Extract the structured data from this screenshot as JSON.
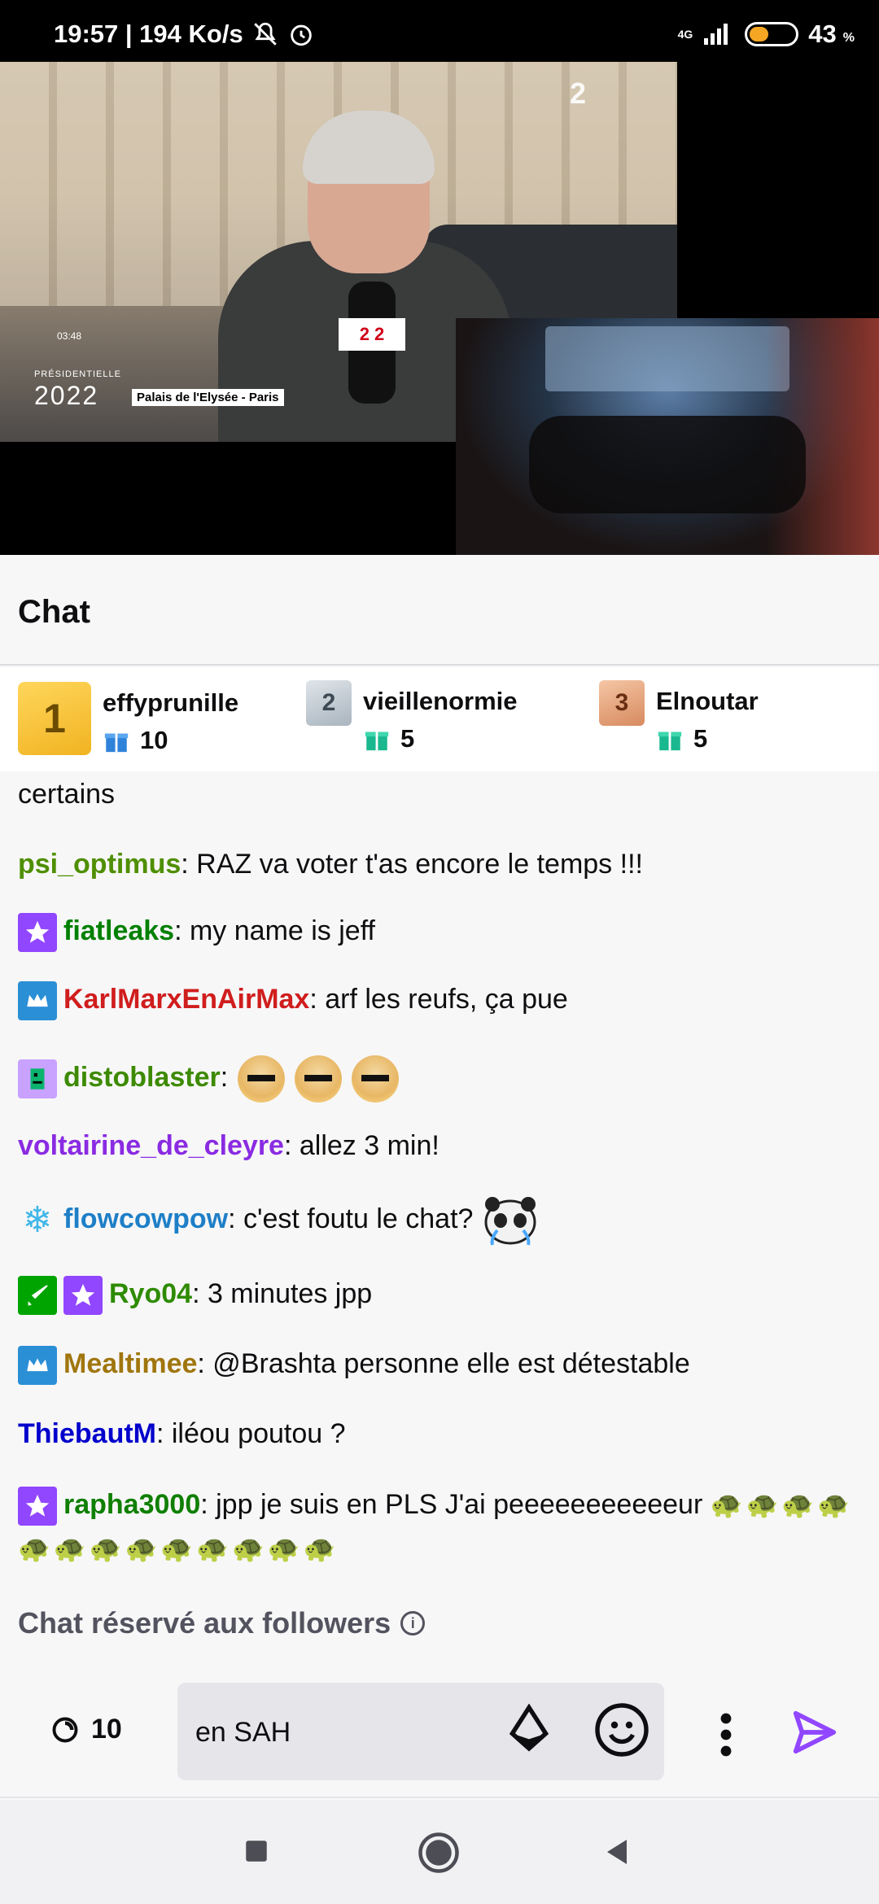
{
  "status_bar": {
    "time_info": "19:57 | 194 Ko/s",
    "network": "4G",
    "battery": "43",
    "battery_unit": "%",
    "battery_level": 0.43
  },
  "video": {
    "brand": "2",
    "clock": "03:48",
    "event_label": "PRÉSIDENTIELLE",
    "event_year": "2022",
    "location": "Palais de l'Elysée - Paris",
    "mic_label": "2 2"
  },
  "chat": {
    "title": "Chat",
    "leaderboard": [
      {
        "rank": "1",
        "name": "effyprunille",
        "gifts": "10"
      },
      {
        "rank": "2",
        "name": "vieillenormie",
        "gifts": "5"
      },
      {
        "rank": "3",
        "name": "Elnoutar",
        "gifts": "5"
      }
    ],
    "messages": [
      {
        "user": "",
        "text": "certains"
      },
      {
        "user": "psi_optimus",
        "text": ": RAZ va voter t'as encore le temps !!!"
      },
      {
        "user": "fiatleaks",
        "text": ": my name is jeff"
      },
      {
        "user": "KarlMarxEnAirMax",
        "text": ": arf les reufs, ça pue"
      },
      {
        "user": "distoblaster",
        "text": ":"
      },
      {
        "user": "voltairine_de_cleyre",
        "text": ": allez 3 min!"
      },
      {
        "user": "flowcowpow",
        "text": ": c'est foutu le chat?"
      },
      {
        "user": "Ryo04",
        "text": ": 3 minutes jpp"
      },
      {
        "user": "Mealtimee",
        "text": ": @Brashta personne elle est détestable"
      },
      {
        "user": "ThiebautM",
        "text": ": iléou poutou ?"
      },
      {
        "user": "rapha3000",
        "text": ": jpp je suis en PLS J'ai peeeeeeeeeeeur"
      }
    ],
    "followers_note": "Chat réservé aux followers",
    "colors": {
      "psi_optimus": "#4f8f00",
      "fiatleaks": "#008000",
      "KarlMarxEnAirMax": "#d01d1d",
      "distoblaster": "#3d8a00",
      "voltairine_de_cleyre": "#8a2be2",
      "flowcowpow": "#1e7fc7",
      "Ryo04": "#2e8b00",
      "Mealtimee": "#a0760d",
      "ThiebautM": "#0000cc",
      "rapha3000": "#0f7f00"
    }
  },
  "input_bar": {
    "points": "10",
    "message_value": "en SAH"
  },
  "icons": {
    "status": [
      "mute-bell-icon",
      "alarm-icon",
      "signal-icon",
      "battery-icon"
    ],
    "input": [
      "channel-points-icon",
      "bits-icon",
      "emoji-icon",
      "more-icon",
      "send-icon"
    ],
    "nav": [
      "recent-apps-icon",
      "home-icon",
      "back-icon"
    ]
  }
}
